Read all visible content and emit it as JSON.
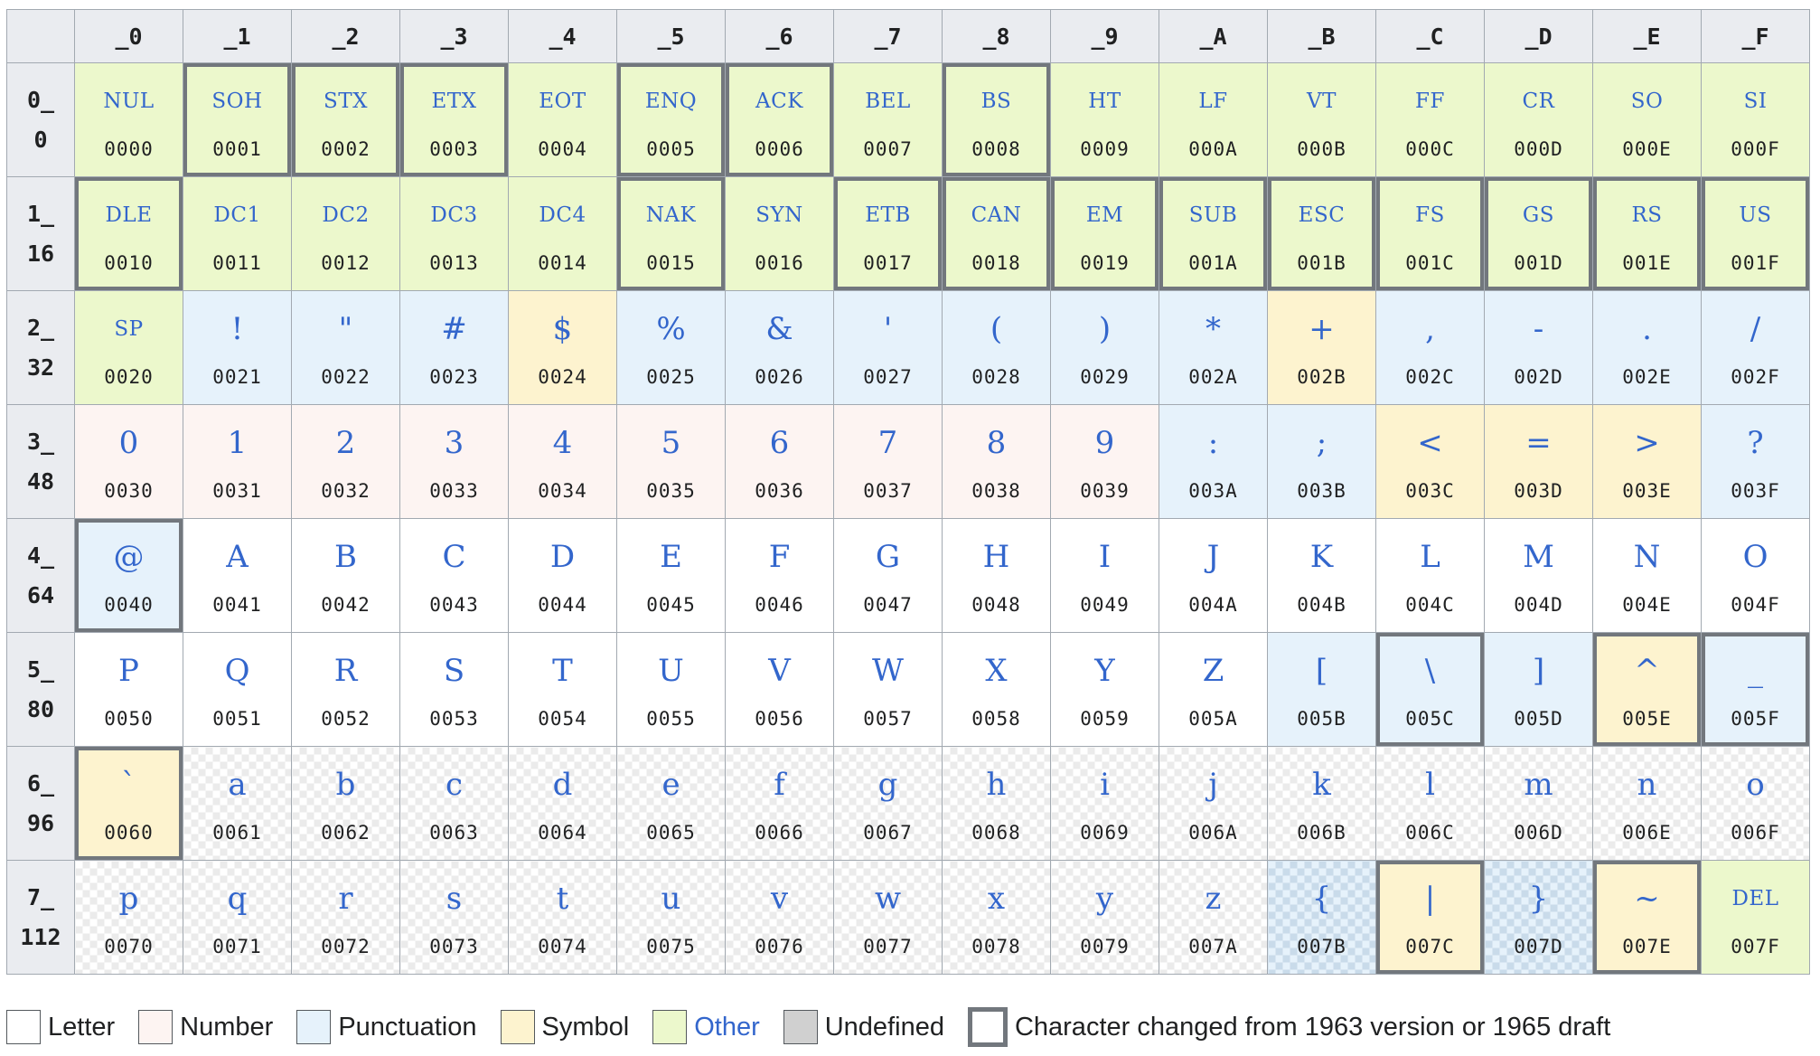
{
  "header": {
    "columns": [
      "_0",
      "_1",
      "_2",
      "_3",
      "_4",
      "_5",
      "_6",
      "_7",
      "_8",
      "_9",
      "_A",
      "_B",
      "_C",
      "_D",
      "_E",
      "_F"
    ]
  },
  "rows": [
    {
      "head": "0_",
      "dec": "0",
      "cells": [
        {
          "g": "NUL",
          "code": "0000",
          "cat": "other",
          "abbr": true
        },
        {
          "g": "SOH",
          "code": "0001",
          "cat": "other",
          "abbr": true,
          "changed": true
        },
        {
          "g": "STX",
          "code": "0002",
          "cat": "other",
          "abbr": true,
          "changed": true
        },
        {
          "g": "ETX",
          "code": "0003",
          "cat": "other",
          "abbr": true,
          "changed": true
        },
        {
          "g": "EOT",
          "code": "0004",
          "cat": "other",
          "abbr": true
        },
        {
          "g": "ENQ",
          "code": "0005",
          "cat": "other",
          "abbr": true,
          "changed": true
        },
        {
          "g": "ACK",
          "code": "0006",
          "cat": "other",
          "abbr": true,
          "changed": true
        },
        {
          "g": "BEL",
          "code": "0007",
          "cat": "other",
          "abbr": true
        },
        {
          "g": "BS",
          "code": "0008",
          "cat": "other",
          "abbr": true,
          "changed": true
        },
        {
          "g": "HT",
          "code": "0009",
          "cat": "other",
          "abbr": true
        },
        {
          "g": "LF",
          "code": "000A",
          "cat": "other",
          "abbr": true
        },
        {
          "g": "VT",
          "code": "000B",
          "cat": "other",
          "abbr": true
        },
        {
          "g": "FF",
          "code": "000C",
          "cat": "other",
          "abbr": true
        },
        {
          "g": "CR",
          "code": "000D",
          "cat": "other",
          "abbr": true
        },
        {
          "g": "SO",
          "code": "000E",
          "cat": "other",
          "abbr": true
        },
        {
          "g": "SI",
          "code": "000F",
          "cat": "other",
          "abbr": true
        }
      ]
    },
    {
      "head": "1_",
      "dec": "16",
      "cells": [
        {
          "g": "DLE",
          "code": "0010",
          "cat": "other",
          "abbr": true,
          "changed": true
        },
        {
          "g": "DC1",
          "code": "0011",
          "cat": "other",
          "abbr": true
        },
        {
          "g": "DC2",
          "code": "0012",
          "cat": "other",
          "abbr": true
        },
        {
          "g": "DC3",
          "code": "0013",
          "cat": "other",
          "abbr": true
        },
        {
          "g": "DC4",
          "code": "0014",
          "cat": "other",
          "abbr": true
        },
        {
          "g": "NAK",
          "code": "0015",
          "cat": "other",
          "abbr": true,
          "changed": true
        },
        {
          "g": "SYN",
          "code": "0016",
          "cat": "other",
          "abbr": true
        },
        {
          "g": "ETB",
          "code": "0017",
          "cat": "other",
          "abbr": true,
          "changed": true
        },
        {
          "g": "CAN",
          "code": "0018",
          "cat": "other",
          "abbr": true,
          "changed": true
        },
        {
          "g": "EM",
          "code": "0019",
          "cat": "other",
          "abbr": true,
          "changed": true
        },
        {
          "g": "SUB",
          "code": "001A",
          "cat": "other",
          "abbr": true,
          "changed": true
        },
        {
          "g": "ESC",
          "code": "001B",
          "cat": "other",
          "abbr": true,
          "changed": true
        },
        {
          "g": "FS",
          "code": "001C",
          "cat": "other",
          "abbr": true,
          "changed": true
        },
        {
          "g": "GS",
          "code": "001D",
          "cat": "other",
          "abbr": true,
          "changed": true
        },
        {
          "g": "RS",
          "code": "001E",
          "cat": "other",
          "abbr": true,
          "changed": true
        },
        {
          "g": "US",
          "code": "001F",
          "cat": "other",
          "abbr": true,
          "changed": true
        }
      ]
    },
    {
      "head": "2_",
      "dec": "32",
      "cells": [
        {
          "g": "SP",
          "code": "0020",
          "cat": "other",
          "abbr": true
        },
        {
          "g": "!",
          "code": "0021",
          "cat": "punct"
        },
        {
          "g": "\"",
          "code": "0022",
          "cat": "punct"
        },
        {
          "g": "#",
          "code": "0023",
          "cat": "punct"
        },
        {
          "g": "$",
          "code": "0024",
          "cat": "symbol"
        },
        {
          "g": "%",
          "code": "0025",
          "cat": "punct"
        },
        {
          "g": "&",
          "code": "0026",
          "cat": "punct"
        },
        {
          "g": "'",
          "code": "0027",
          "cat": "punct"
        },
        {
          "g": "(",
          "code": "0028",
          "cat": "punct"
        },
        {
          "g": ")",
          "code": "0029",
          "cat": "punct"
        },
        {
          "g": "*",
          "code": "002A",
          "cat": "punct"
        },
        {
          "g": "+",
          "code": "002B",
          "cat": "symbol"
        },
        {
          "g": ",",
          "code": "002C",
          "cat": "punct"
        },
        {
          "g": "-",
          "code": "002D",
          "cat": "punct"
        },
        {
          "g": ".",
          "code": "002E",
          "cat": "punct"
        },
        {
          "g": "/",
          "code": "002F",
          "cat": "punct"
        }
      ]
    },
    {
      "head": "3_",
      "dec": "48",
      "cells": [
        {
          "g": "0",
          "code": "0030",
          "cat": "number"
        },
        {
          "g": "1",
          "code": "0031",
          "cat": "number"
        },
        {
          "g": "2",
          "code": "0032",
          "cat": "number"
        },
        {
          "g": "3",
          "code": "0033",
          "cat": "number"
        },
        {
          "g": "4",
          "code": "0034",
          "cat": "number"
        },
        {
          "g": "5",
          "code": "0035",
          "cat": "number"
        },
        {
          "g": "6",
          "code": "0036",
          "cat": "number"
        },
        {
          "g": "7",
          "code": "0037",
          "cat": "number"
        },
        {
          "g": "8",
          "code": "0038",
          "cat": "number"
        },
        {
          "g": "9",
          "code": "0039",
          "cat": "number"
        },
        {
          "g": ":",
          "code": "003A",
          "cat": "punct"
        },
        {
          "g": ";",
          "code": "003B",
          "cat": "punct"
        },
        {
          "g": "<",
          "code": "003C",
          "cat": "symbol"
        },
        {
          "g": "=",
          "code": "003D",
          "cat": "symbol"
        },
        {
          "g": ">",
          "code": "003E",
          "cat": "symbol"
        },
        {
          "g": "?",
          "code": "003F",
          "cat": "punct"
        }
      ]
    },
    {
      "head": "4_",
      "dec": "64",
      "cells": [
        {
          "g": "@",
          "code": "0040",
          "cat": "punct",
          "changed": true
        },
        {
          "g": "A",
          "code": "0041",
          "cat": "letter"
        },
        {
          "g": "B",
          "code": "0042",
          "cat": "letter"
        },
        {
          "g": "C",
          "code": "0043",
          "cat": "letter"
        },
        {
          "g": "D",
          "code": "0044",
          "cat": "letter"
        },
        {
          "g": "E",
          "code": "0045",
          "cat": "letter"
        },
        {
          "g": "F",
          "code": "0046",
          "cat": "letter"
        },
        {
          "g": "G",
          "code": "0047",
          "cat": "letter"
        },
        {
          "g": "H",
          "code": "0048",
          "cat": "letter"
        },
        {
          "g": "I",
          "code": "0049",
          "cat": "letter"
        },
        {
          "g": "J",
          "code": "004A",
          "cat": "letter"
        },
        {
          "g": "K",
          "code": "004B",
          "cat": "letter"
        },
        {
          "g": "L",
          "code": "004C",
          "cat": "letter"
        },
        {
          "g": "M",
          "code": "004D",
          "cat": "letter"
        },
        {
          "g": "N",
          "code": "004E",
          "cat": "letter"
        },
        {
          "g": "O",
          "code": "004F",
          "cat": "letter"
        }
      ]
    },
    {
      "head": "5_",
      "dec": "80",
      "cells": [
        {
          "g": "P",
          "code": "0050",
          "cat": "letter"
        },
        {
          "g": "Q",
          "code": "0051",
          "cat": "letter"
        },
        {
          "g": "R",
          "code": "0052",
          "cat": "letter"
        },
        {
          "g": "S",
          "code": "0053",
          "cat": "letter"
        },
        {
          "g": "T",
          "code": "0054",
          "cat": "letter"
        },
        {
          "g": "U",
          "code": "0055",
          "cat": "letter"
        },
        {
          "g": "V",
          "code": "0056",
          "cat": "letter"
        },
        {
          "g": "W",
          "code": "0057",
          "cat": "letter"
        },
        {
          "g": "X",
          "code": "0058",
          "cat": "letter"
        },
        {
          "g": "Y",
          "code": "0059",
          "cat": "letter"
        },
        {
          "g": "Z",
          "code": "005A",
          "cat": "letter"
        },
        {
          "g": "[",
          "code": "005B",
          "cat": "punct"
        },
        {
          "g": "\\",
          "code": "005C",
          "cat": "punct",
          "changed": true
        },
        {
          "g": "]",
          "code": "005D",
          "cat": "punct"
        },
        {
          "g": "^",
          "code": "005E",
          "cat": "symbol",
          "changed": true
        },
        {
          "g": "_",
          "code": "005F",
          "cat": "punct",
          "changed": true
        }
      ]
    },
    {
      "head": "6_",
      "dec": "96",
      "cells": [
        {
          "g": "`",
          "code": "0060",
          "cat": "symbol",
          "changed": true
        },
        {
          "g": "a",
          "code": "0061",
          "cat": "lower"
        },
        {
          "g": "b",
          "code": "0062",
          "cat": "lower"
        },
        {
          "g": "c",
          "code": "0063",
          "cat": "lower"
        },
        {
          "g": "d",
          "code": "0064",
          "cat": "lower"
        },
        {
          "g": "e",
          "code": "0065",
          "cat": "lower"
        },
        {
          "g": "f",
          "code": "0066",
          "cat": "lower"
        },
        {
          "g": "g",
          "code": "0067",
          "cat": "lower"
        },
        {
          "g": "h",
          "code": "0068",
          "cat": "lower"
        },
        {
          "g": "i",
          "code": "0069",
          "cat": "lower"
        },
        {
          "g": "j",
          "code": "006A",
          "cat": "lower"
        },
        {
          "g": "k",
          "code": "006B",
          "cat": "lower"
        },
        {
          "g": "l",
          "code": "006C",
          "cat": "lower"
        },
        {
          "g": "m",
          "code": "006D",
          "cat": "lower"
        },
        {
          "g": "n",
          "code": "006E",
          "cat": "lower"
        },
        {
          "g": "o",
          "code": "006F",
          "cat": "lower"
        }
      ]
    },
    {
      "head": "7_",
      "dec": "112",
      "cells": [
        {
          "g": "p",
          "code": "0070",
          "cat": "lower"
        },
        {
          "g": "q",
          "code": "0071",
          "cat": "lower"
        },
        {
          "g": "r",
          "code": "0072",
          "cat": "lower"
        },
        {
          "g": "s",
          "code": "0073",
          "cat": "lower"
        },
        {
          "g": "t",
          "code": "0074",
          "cat": "lower"
        },
        {
          "g": "u",
          "code": "0075",
          "cat": "lower"
        },
        {
          "g": "v",
          "code": "0076",
          "cat": "lower"
        },
        {
          "g": "w",
          "code": "0077",
          "cat": "lower"
        },
        {
          "g": "x",
          "code": "0078",
          "cat": "lower"
        },
        {
          "g": "y",
          "code": "0079",
          "cat": "lower"
        },
        {
          "g": "z",
          "code": "007A",
          "cat": "lower"
        },
        {
          "g": "{",
          "code": "007B",
          "cat": "lower-punct"
        },
        {
          "g": "|",
          "code": "007C",
          "cat": "symbol",
          "changed": true
        },
        {
          "g": "}",
          "code": "007D",
          "cat": "lower-punct"
        },
        {
          "g": "~",
          "code": "007E",
          "cat": "symbol",
          "changed": true
        },
        {
          "g": "DEL",
          "code": "007F",
          "cat": "other",
          "abbr": true
        }
      ]
    }
  ],
  "legend": {
    "letter": "Letter",
    "number": "Number",
    "punctuation": "Punctuation",
    "symbol": "Symbol",
    "other": "Other",
    "undefined": "Undefined",
    "changed": "Character changed from 1963 version or 1965 draft"
  },
  "colors": {
    "letter": "#ffffff",
    "number": "#fdf4f2",
    "punctuation": "#e6f2fb",
    "symbol": "#fdf3cf",
    "other": "#ecf8cc",
    "undefined": "#d0d0d0",
    "changed_border": "#72777d",
    "link": "#3366cc"
  }
}
